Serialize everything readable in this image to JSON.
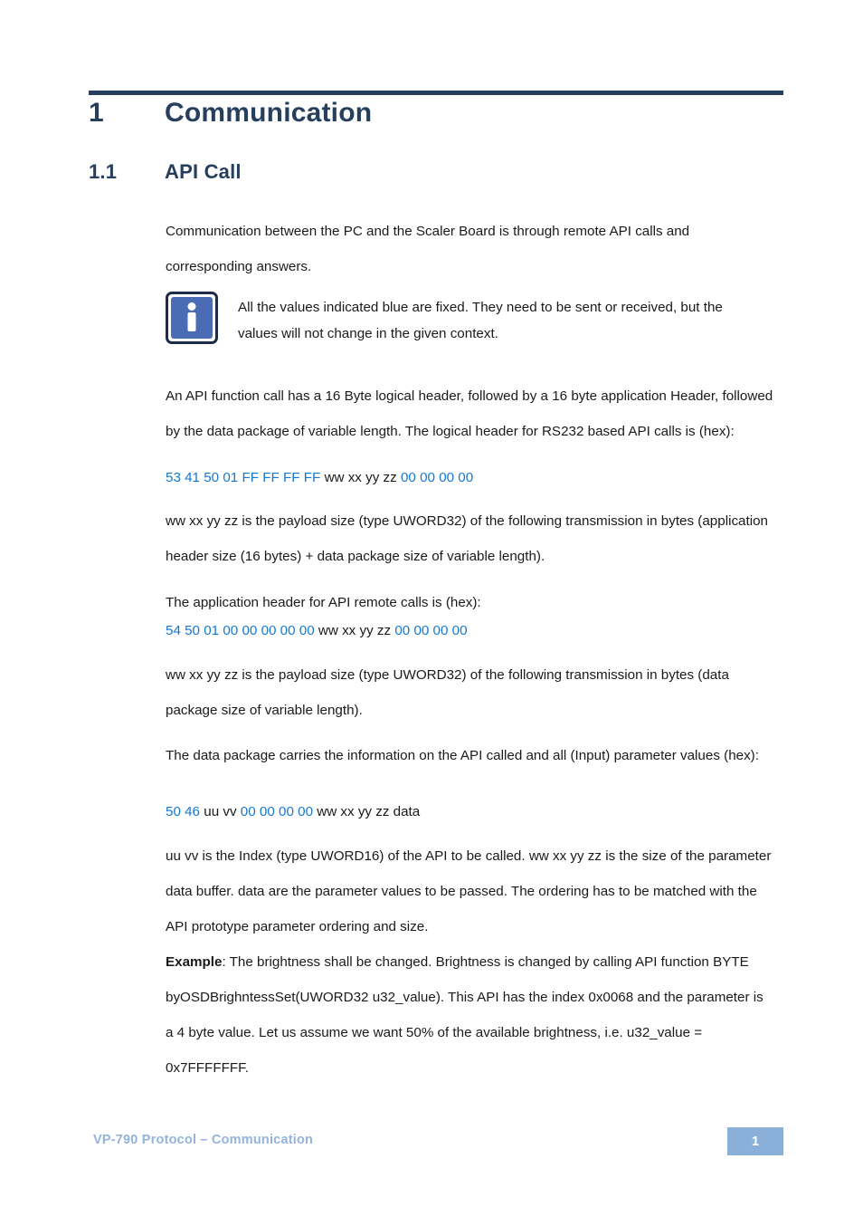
{
  "document": {
    "heading1": {
      "number": "1",
      "title": "Communication"
    },
    "heading2": {
      "number": "1.1",
      "title": "API Call"
    },
    "paragraphs": {
      "intro": "Communication between the PC and the Scaler Board is through remote API calls and corresponding answers.",
      "note": "All the values indicated blue are fixed. They need to be sent or received, but the values will not change in the given context.",
      "logical_header_intro": "An API function call has a 16 Byte logical header, followed by a 16 byte application Header, followed by the data package of variable length. The logical header for RS232 based API calls is (hex):",
      "payload_size_1": "ww xx yy zz is the payload size (type UWORD32) of the following transmission in bytes (application header size (16 bytes) + data package size of variable length).",
      "app_header_intro": "The application header for API remote calls is (hex):",
      "payload_size_2": "ww xx yy zz is the payload size (type UWORD32) of the following transmission in bytes (data package size of variable length).",
      "data_package_intro": "The data package carries the information on the API called and all (Input) parameter values (hex):",
      "index_explanation": "uu vv is the Index (type UWORD16) of the API to be called. ww xx yy zz is the size of the parameter data buffer. data are the parameter values to be passed. The ordering has to be matched with the API prototype parameter ordering and size.",
      "example_label": "Example",
      "example_body": ": The brightness shall be changed. Brightness is changed by calling API function BYTE byOSDBrighntessSet(UWORD32 u32_value). This API has the index 0x0068 and the parameter is a 4 byte value. Let us assume we want 50% of the available brightness, i.e. u32_value = 0x7FFFFFFF."
    },
    "hex_lines": {
      "logical_header": {
        "fixed_prefix": "53 41 50 01 FF FF FF FF",
        "variable_mid": "ww xx yy zz",
        "fixed_suffix": "00 00 00 00"
      },
      "application_header": {
        "fixed_prefix": "54 50 01 00 00 00 00 00",
        "variable_mid": "ww xx yy zz",
        "fixed_suffix": "00 00 00 00"
      },
      "data_package": {
        "fixed_prefix": "50 46",
        "variable_mid": "uu vv",
        "fixed_middle": "00 00 00 00",
        "variable_suffix": "ww xx yy zz data"
      }
    },
    "note_icon": "info-icon",
    "footer": {
      "text": "VP-790 Protocol –  Communication",
      "page_number": "1"
    },
    "colors": {
      "heading": "#263f5c",
      "hex_fixed_blue": "#1478d2",
      "footer_text": "#94b3dd",
      "page_badge_bg": "#8ab0d9",
      "note_icon_fill": "#4a6cb5",
      "note_icon_border": "#1d2c48"
    }
  }
}
